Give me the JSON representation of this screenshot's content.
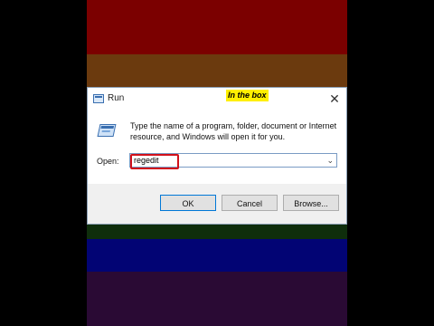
{
  "dialog": {
    "title": "Run",
    "close_glyph": "✕",
    "annotation": "In the box",
    "description": "Type the name of a program, folder, document or Internet resource, and Windows will open it for you.",
    "open_label": "Open:",
    "open_value": "regedit",
    "dropdown_glyph": "⌄",
    "buttons": {
      "ok": "OK",
      "cancel": "Cancel",
      "browse": "Browse..."
    }
  },
  "colors": {
    "band_top": "#7b0000",
    "band_second": "#6b3a0e",
    "band_blue": "#020474",
    "band_bottom": "#2a0a34",
    "highlight": "#d1111b",
    "annotation_bg": "#ffef00"
  },
  "icons": [
    "run-app-icon",
    "close-icon",
    "chevron-down-icon"
  ]
}
